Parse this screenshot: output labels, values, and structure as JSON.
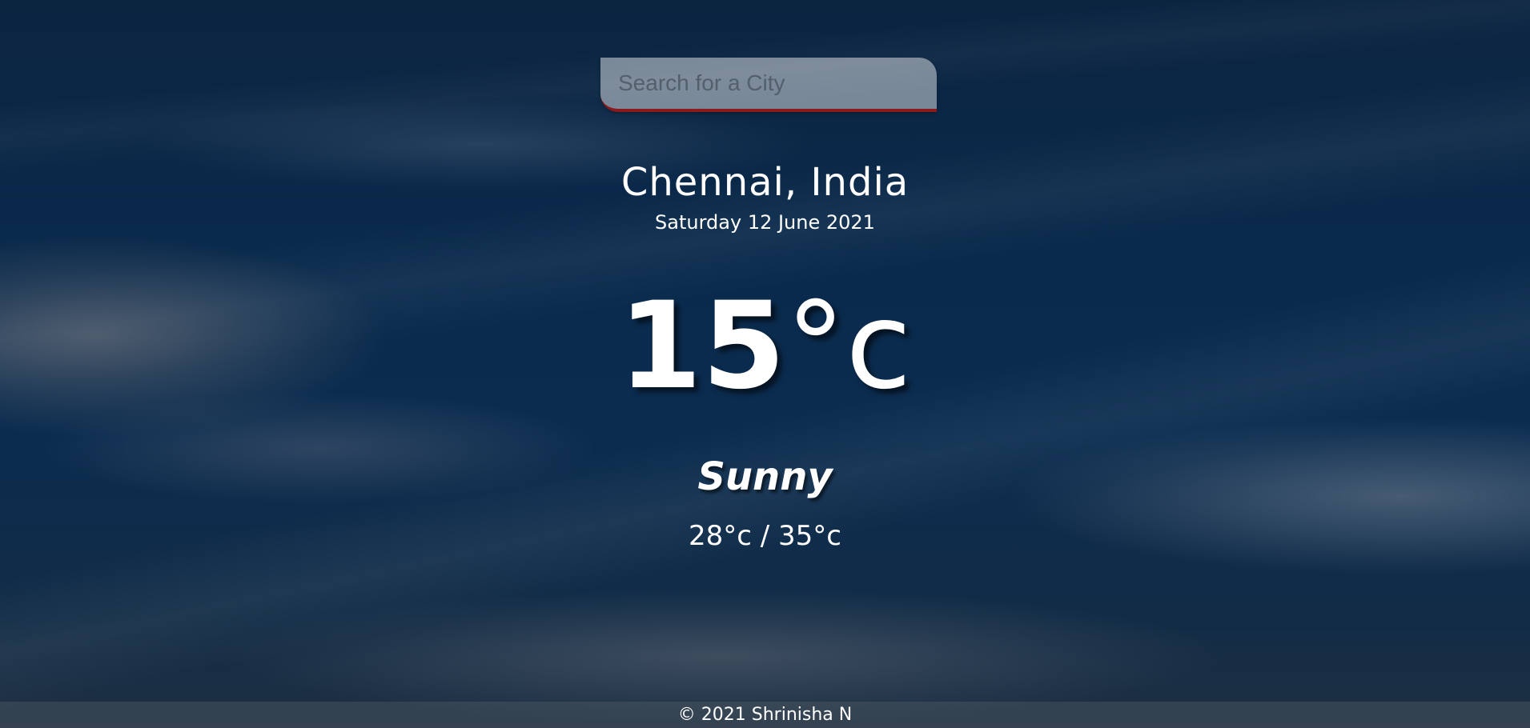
{
  "search": {
    "placeholder": "Search for a City",
    "value": ""
  },
  "location": {
    "city_country": "Chennai, India",
    "date": "Saturday 12 June 2021"
  },
  "current": {
    "temperature": "15",
    "unit": "°c",
    "condition": "Sunny",
    "hi_low": "28°c / 35°c"
  },
  "footer": {
    "text": "© 2021 Shrinisha N"
  },
  "colors": {
    "search_underline": "#8b1a1a",
    "text": "#ffffff"
  }
}
